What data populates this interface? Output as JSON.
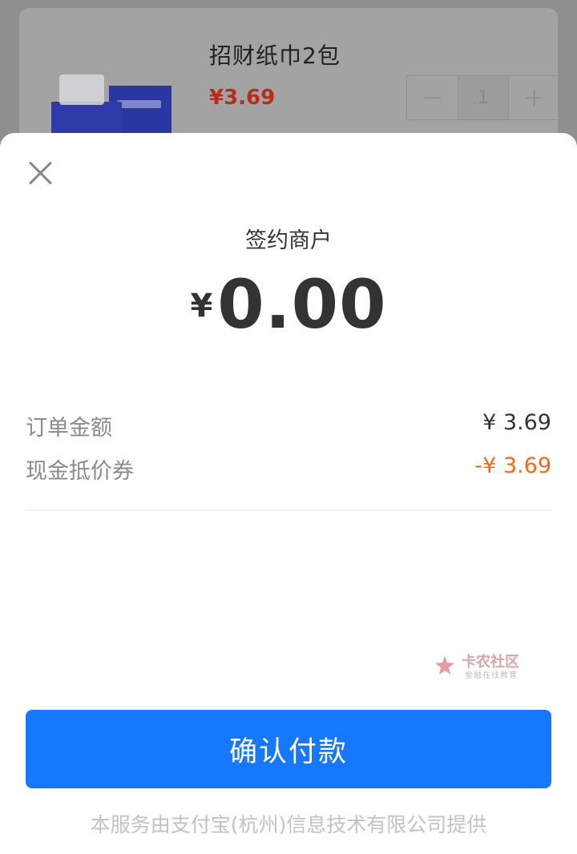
{
  "background_product": {
    "title": "招财纸巾2包",
    "price": "¥3.69",
    "quantity": "1",
    "decrement_symbol": "−",
    "increment_symbol": "+"
  },
  "sheet": {
    "merchant_name": "签约商户",
    "amount_currency": "¥",
    "amount_value": "0.00",
    "rows": [
      {
        "label": "订单金额",
        "value": "¥ 3.69"
      },
      {
        "label": "现金抵价券",
        "value": "-¥ 3.69"
      }
    ],
    "confirm_label": "确认付款",
    "footer_text": "本服务由支付宝(杭州)信息技术有限公司提供"
  },
  "watermark": {
    "title": "卡农社区",
    "subtitle": "金融在线教育"
  },
  "colors": {
    "primary_button": "#1677ff",
    "discount_text": "#f26a1b",
    "product_price": "#b82c1c"
  },
  "icons": {
    "close": "close-icon",
    "logo": "watermark-logo-icon"
  }
}
